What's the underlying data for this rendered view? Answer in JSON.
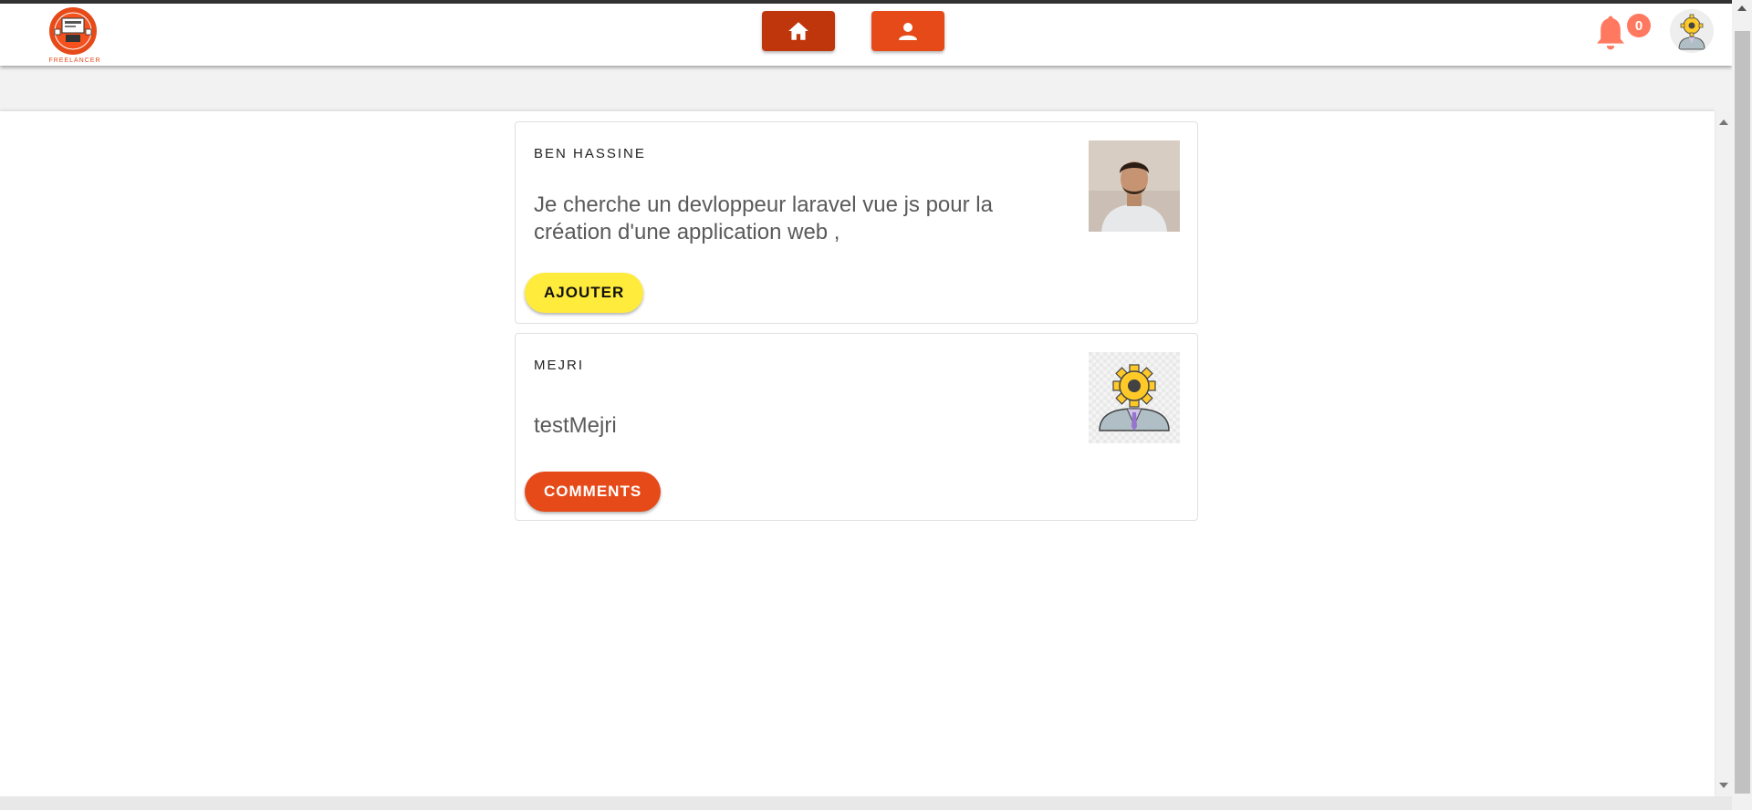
{
  "header": {
    "logo_label": "FREELANCER",
    "nav": [
      {
        "name": "home",
        "icon": "home-icon",
        "color": "#bf360c"
      },
      {
        "name": "profile",
        "icon": "person-icon",
        "color": "#e64a19"
      }
    ],
    "notifications": {
      "icon": "bell-icon",
      "count": "0",
      "color": "#ff7961"
    },
    "avatar_icon": "gear-head-avatar-icon"
  },
  "posts": [
    {
      "author": "BEN HASSINE",
      "text": "Je cherche un devloppeur laravel vue js pour la création d'une application web ,",
      "button_label": "AJOUTER",
      "button_color": "#ffeb3b",
      "image": "user-photo"
    },
    {
      "author": "MEJRI",
      "text": "testMejri",
      "button_label": "COMMENTS",
      "button_color": "#e64a19",
      "image": "gear-head-avatar"
    }
  ]
}
